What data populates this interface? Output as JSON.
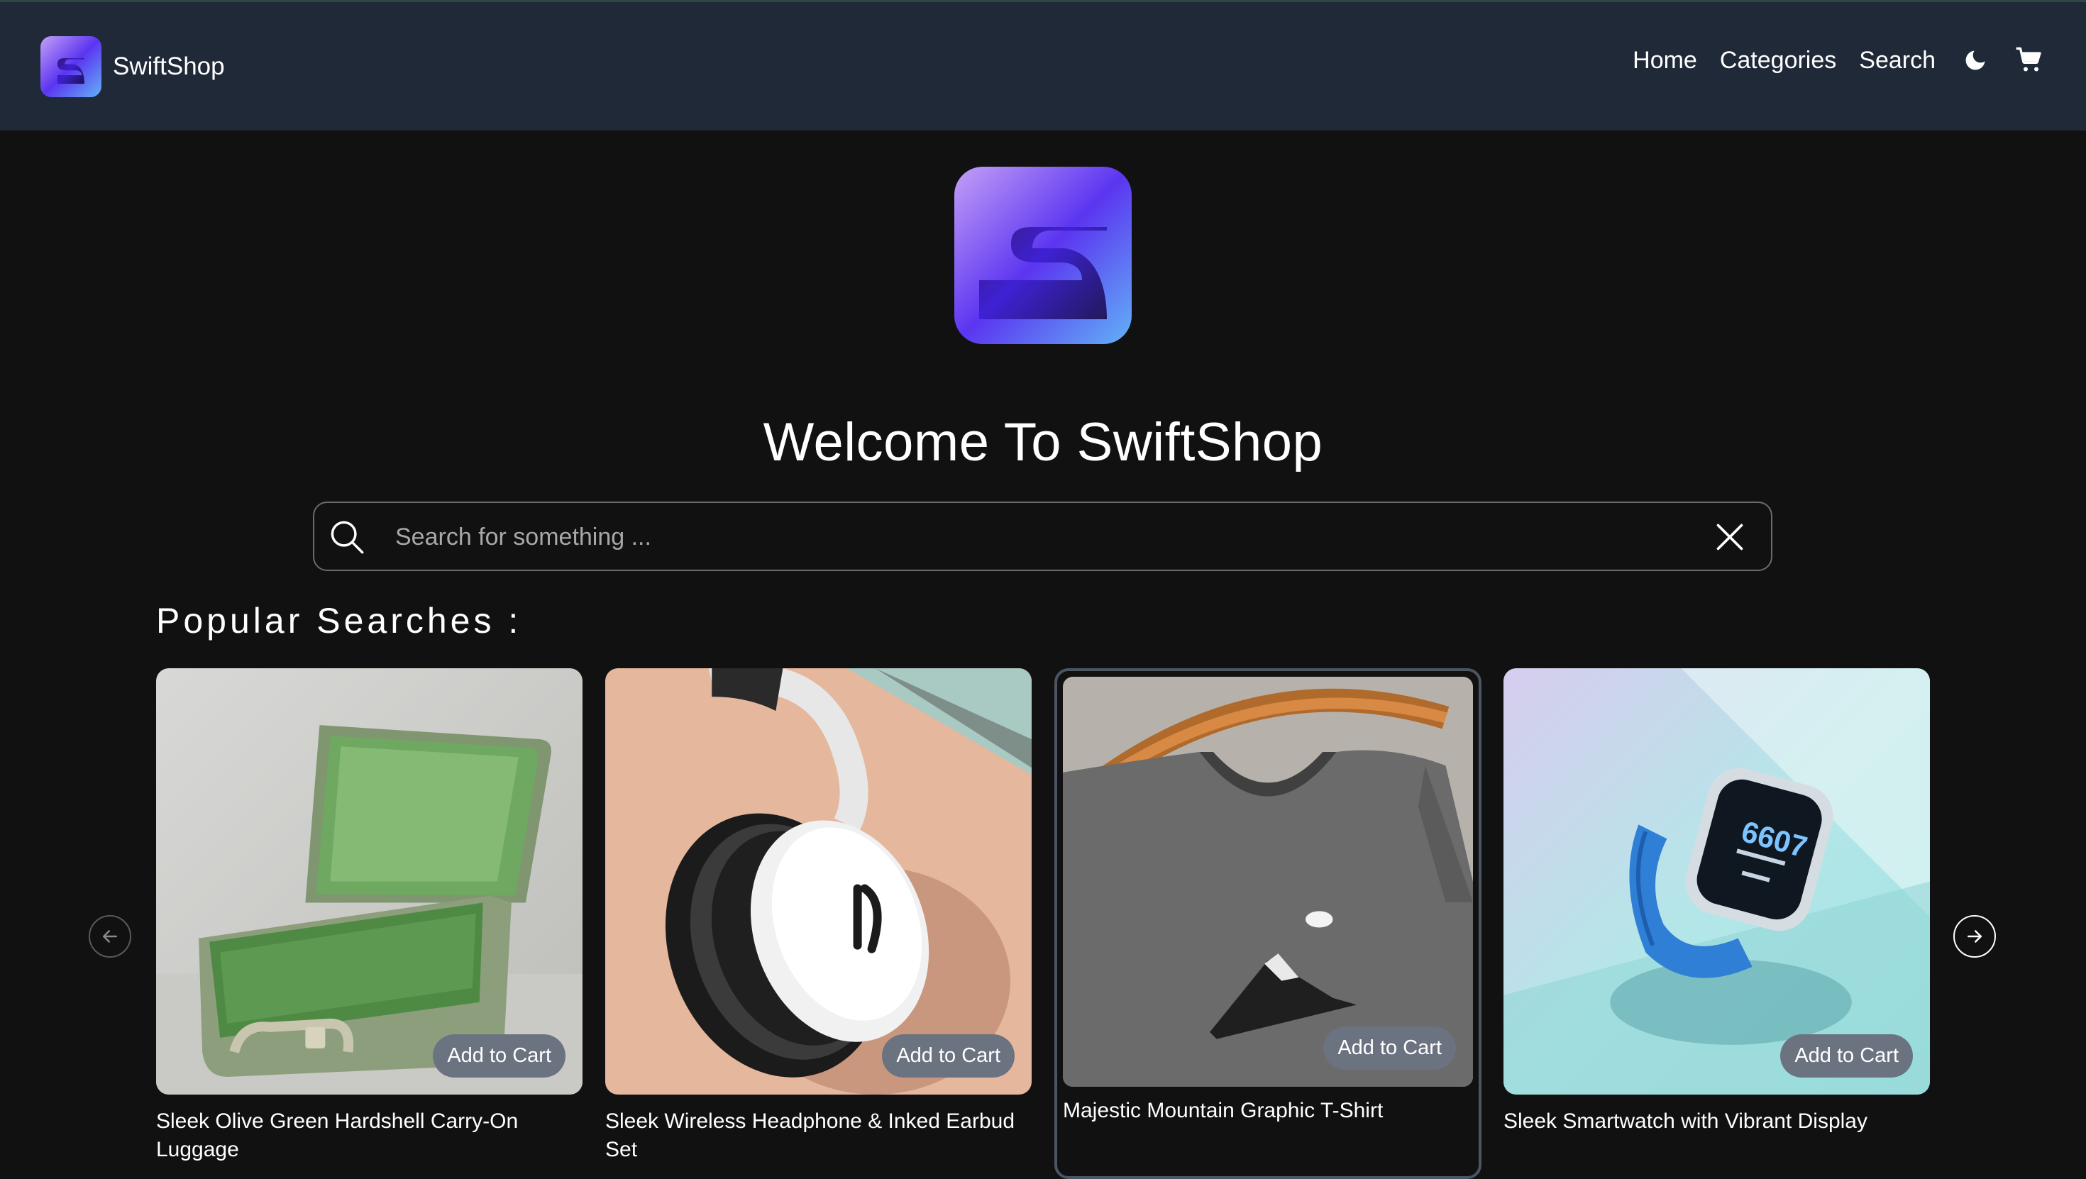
{
  "header": {
    "brand": "SwiftShop",
    "nav": {
      "home": "Home",
      "categories": "Categories",
      "search": "Search"
    },
    "icons": [
      "moon-icon",
      "cart-icon"
    ]
  },
  "hero": {
    "title": "Welcome To SwiftShop"
  },
  "search": {
    "placeholder": "Search for something ...",
    "value": ""
  },
  "popular": {
    "title": "Popular Searches :",
    "products": [
      {
        "name": "Sleek Olive Green Hardshell Carry-On Luggage",
        "button": "Add to Cart"
      },
      {
        "name": "Sleek Wireless Headphone & Inked Earbud Set",
        "button": "Add to Cart"
      },
      {
        "name": "Majestic Mountain Graphic T-Shirt",
        "button": "Add to Cart"
      },
      {
        "name": "Sleek Smartwatch with Vibrant Display",
        "button": "Add to Cart"
      }
    ]
  },
  "colors": {
    "header_bg": "#1f2937",
    "page_bg": "#111111",
    "button_bg": "#6b7280",
    "brand_gradient": [
      "#c084fc",
      "#4f46e5",
      "#60a5fa"
    ]
  }
}
